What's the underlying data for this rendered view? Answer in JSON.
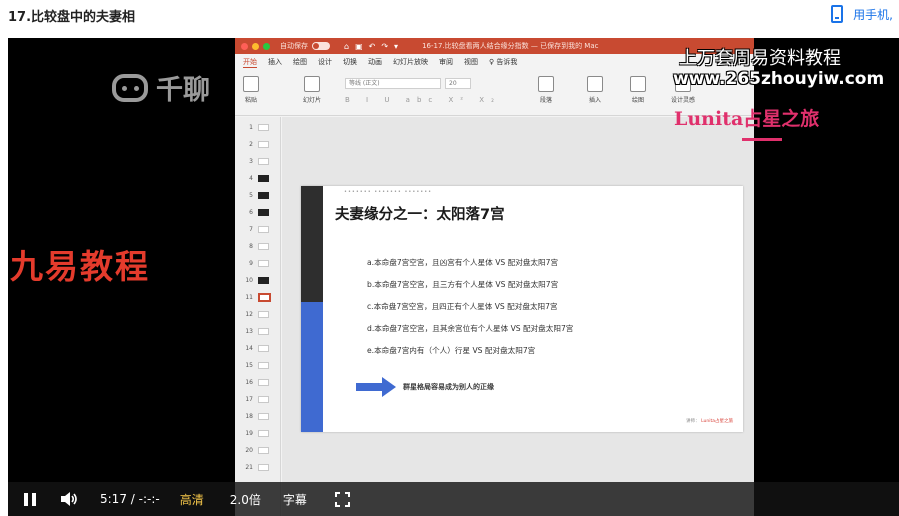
{
  "page": {
    "title": "17.比较盘中的夫妻相",
    "phone_link": "用手机,"
  },
  "watermarks": {
    "qianliao": "千聊",
    "jiuyi": "九易教程",
    "right_line1": "上万套周易资料教程",
    "right_line2": "www.265zhouyiw.com",
    "right_line3": "Lunita占星之旅"
  },
  "ppt": {
    "titlebar": {
      "autosave": "自动保存",
      "toggle": "关闭",
      "document": "16-17.比较盘看两人结合缘分指数 — 已保存到我的 Mac"
    },
    "tabs": [
      "开始",
      "插入",
      "绘图",
      "设计",
      "切换",
      "动画",
      "幻灯片放映",
      "审阅",
      "视图",
      "♀ 告诉我"
    ],
    "ribbon": {
      "paste": "粘贴",
      "new_slide": "幻灯片",
      "font_name": "等线 (正文)",
      "font_size": "20",
      "format_marks": "B I U abc X² X₂",
      "paragraph": "段落",
      "insert": "插入",
      "drawing": "绘图",
      "design": "设计灵感"
    },
    "thumbnails": [
      "1",
      "2",
      "3",
      "4",
      "5",
      "6",
      "7",
      "8",
      "9",
      "10",
      "11",
      "12",
      "13",
      "14",
      "15",
      "16",
      "17",
      "18",
      "19",
      "20",
      "21"
    ],
    "selected_thumbnail": "11"
  },
  "slide": {
    "tiny_header": "••••••• ••••••• •••••••",
    "title": "夫妻缘分之一：太阳落7宫",
    "bullets": [
      "a.本命盘7宫空宫，且凶宫有个人星体 VS 配对盘太阳7宫",
      "b.本命盘7宫空宫，且三方有个人星体 VS 配对盘太阳7宫",
      "c.本命盘7宫空宫，且四正有个人星体 VS 配对盘太阳7宫",
      "d.本命盘7宫空宫，且其余宫位有个人星体 VS 配对盘太阳7宫",
      "e.本命盘7宫内有（个人）行星 VS 配对盘太阳7宫"
    ],
    "arrow_text": "群星格局容易成为别人的正缘",
    "footer_a": "讲师：",
    "footer_b": "Lunita占星之旅"
  },
  "controls": {
    "time_current": "5:17",
    "time_sep": "/",
    "time_total": "-:-:-",
    "quality": "高清",
    "speed": "2.0倍",
    "subtitle": "字幕"
  },
  "colors": {
    "ppt_accent": "#c84a31",
    "slide_blue": "#3f6ad1",
    "quality_text": "#f7c84a",
    "jiuyi_red": "#e43b2c"
  }
}
